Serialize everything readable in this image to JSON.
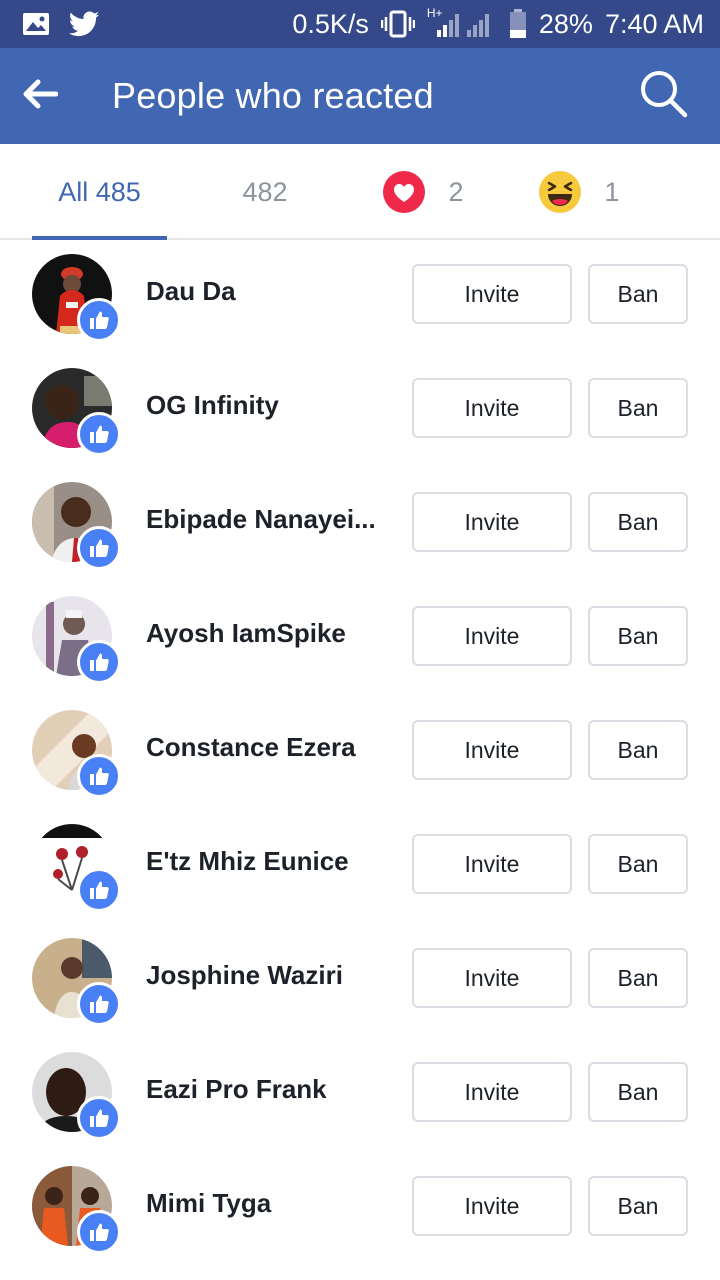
{
  "status_bar": {
    "net_speed": "0.5K/s",
    "network_type": "H+",
    "battery": "28%",
    "time": "7:40 AM",
    "left_icons": [
      "gallery-icon",
      "twitter-icon"
    ],
    "right_icons": [
      "vibrate-icon",
      "signal-icon",
      "battery-icon"
    ]
  },
  "header": {
    "title": "People who reacted",
    "back_icon": "back-arrow-icon",
    "search_icon": "search-icon"
  },
  "tabs": [
    {
      "label": "All 485",
      "active": true
    },
    {
      "label": "482",
      "icon": "like-icon"
    },
    {
      "label": "2",
      "icon": "love-icon"
    },
    {
      "label": "1",
      "icon": "haha-icon"
    }
  ],
  "buttons": {
    "invite": "Invite",
    "ban": "Ban"
  },
  "people": [
    {
      "name": "Dau Da",
      "reaction": "like-icon"
    },
    {
      "name": "OG Infinity",
      "reaction": "like-icon"
    },
    {
      "name": "Ebipade Nanayei...",
      "reaction": "like-icon"
    },
    {
      "name": "Ayosh IamSpike",
      "reaction": "like-icon"
    },
    {
      "name": "Constance Ezera",
      "reaction": "like-icon"
    },
    {
      "name": "E'tz Mhiz Eunice",
      "reaction": "like-icon"
    },
    {
      "name": "Josphine Waziri",
      "reaction": "like-icon"
    },
    {
      "name": "Eazi Pro Frank",
      "reaction": "like-icon"
    },
    {
      "name": "Mimi Tyga",
      "reaction": "like-icon"
    }
  ],
  "colors": {
    "status_bar": "#34488a",
    "header": "#4267b2",
    "accent": "#4267b2",
    "like_badge": "#4a80f5",
    "love": "#f0284a",
    "haha": "#f7c93c"
  }
}
